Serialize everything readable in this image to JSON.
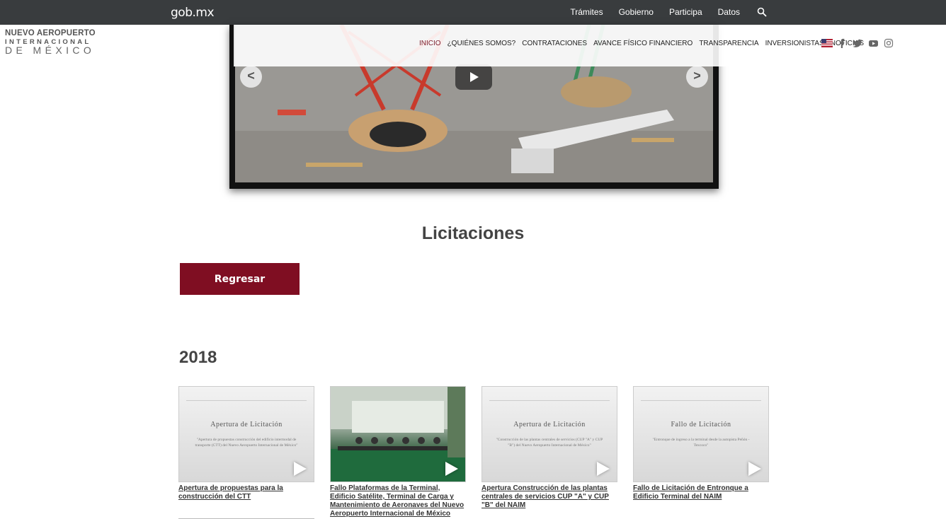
{
  "gobbar": {
    "logo": "gob.mx",
    "nav": [
      "Trámites",
      "Gobierno",
      "Participa",
      "Datos"
    ],
    "search_icon": "search-icon"
  },
  "sitelogo": {
    "line1": "NUEVO AEROPUERTO",
    "line2": "INTERNACIONAL",
    "line3": "DE MÉXICO"
  },
  "sitenav": {
    "items": [
      "INICIO",
      "¿QUIÉNES SOMOS?",
      "CONTRATACIONES",
      "AVANCE FÍSICO FINANCIERO",
      "TRANSPARENCIA",
      "INVERSIONISTAS",
      "NOTICIAS"
    ],
    "active_color": "#7c1d2c",
    "social_icons": [
      "us-flag-icon",
      "facebook-icon",
      "twitter-icon",
      "youtube-icon",
      "instagram-icon"
    ]
  },
  "video": {
    "prev_label": "<",
    "next_label": ">"
  },
  "page": {
    "title": "Licitaciones",
    "back_label": "Regresar",
    "year": "2018",
    "accent": "#7f0e22"
  },
  "cards": [
    {
      "thumb_type": "doc",
      "thumb_title": "Apertura de Licitación",
      "thumb_sub": "\"Apertura de propuestas construcción del edificio intermodal de transporte (CTT) del Nuevo Aeropuerto Internacional de México\"",
      "caption": "Apertura de propuestas para la construcción del CTT"
    },
    {
      "thumb_type": "photo",
      "thumb_title": "",
      "thumb_sub": "",
      "caption": "Fallo Plataformas de la Terminal, Edificio Satélite, Terminal de Carga y Mantenimiento de Aeronaves del Nuevo Aeropuerto Internacional de México"
    },
    {
      "thumb_type": "doc",
      "thumb_title": "Apertura de Licitación",
      "thumb_sub": "\"Construcción de las plantas centrales de servicios (CUP \"A\" y CUP \"B\") del Nuevo Aeropuerto Internacional de México\"",
      "caption": "Apertura Construcción de las plantas centrales de servicios CUP \"A\" y CUP \"B\" del NAIM"
    },
    {
      "thumb_type": "doc",
      "thumb_title": "Fallo de Licitación",
      "thumb_sub": "\"Entronque de ingreso a la terminal desde la autopista Peñón - Texcoco\"",
      "caption": "Fallo de Licitación de Entronque a Edificio Terminal del NAIM"
    }
  ]
}
